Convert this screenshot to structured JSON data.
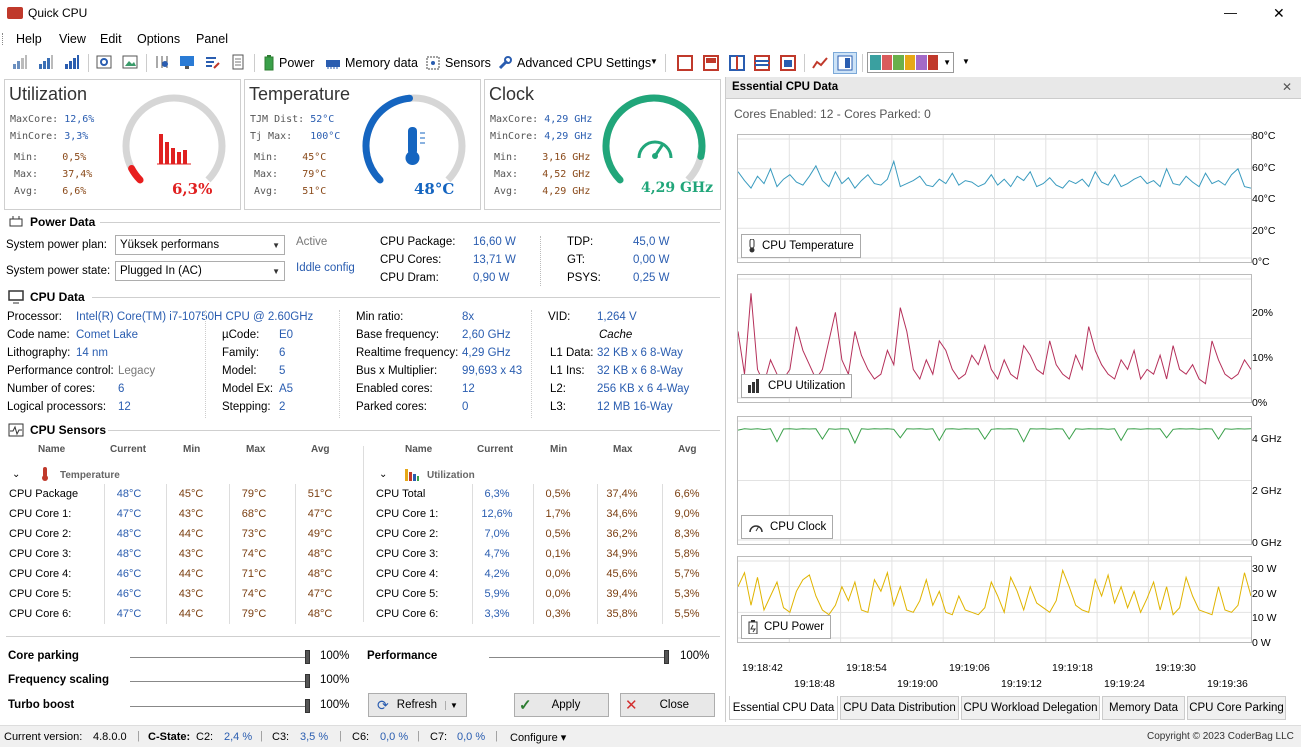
{
  "window": {
    "title": "Quick CPU",
    "min": "—",
    "max": "☐",
    "close": "✕"
  },
  "menu": [
    "Help",
    "View",
    "Edit",
    "Options",
    "Panel"
  ],
  "toolbar": {
    "power": "Power",
    "memory": "Memory data",
    "sensors": "Sensors",
    "advanced": "Advanced CPU Settings"
  },
  "gauges": {
    "utilization": {
      "title": "Utilization",
      "maxcore_l": "MaxCore:",
      "maxcore": "12,6%",
      "mincore_l": "MinCore:",
      "mincore": "3,3%",
      "min_l": "Min:",
      "min": "0,5%",
      "max_l": "Max:",
      "max": "37,4%",
      "avg_l": "Avg:",
      "avg": "6,6%",
      "value": "6,3%",
      "level": 0.063,
      "color": "#e81e1e"
    },
    "temperature": {
      "title": "Temperature",
      "tjm_l": "TJM Dist:",
      "tjm": "52°C",
      "tjmax_l": "Tj Max:",
      "tjmax": "100°C",
      "min_l": "Min:",
      "min": "45°C",
      "max_l": "Max:",
      "max": "79°C",
      "avg_l": "Avg:",
      "avg": "51°C",
      "value": "48°C",
      "level": 0.48,
      "color": "#1565c0"
    },
    "clock": {
      "title": "Clock",
      "maxcore_l": "MaxCore:",
      "maxcore": "4,29 GHz",
      "mincore_l": "MinCore:",
      "mincore": "4,29 GHz",
      "min_l": "Min:",
      "min": "3,16 GHz",
      "max_l": "Max:",
      "max": "4,52 GHz",
      "avg_l": "Avg:",
      "avg": "4,29 GHz",
      "value": "4,29 GHz",
      "level": 0.88,
      "color": "#21a67a"
    }
  },
  "power": {
    "header": "Power Data",
    "plan_label": "System power plan:",
    "plan_value": "Yüksek performans",
    "plan_status": "Active",
    "state_label": "System power state:",
    "state_value": "Plugged In (AC)",
    "state_link": "Iddle config",
    "pkg_l": "CPU Package:",
    "pkg": "16,60 W",
    "cores_l": "CPU Cores:",
    "cores": "13,71 W",
    "dram_l": "CPU Dram:",
    "dram": "0,90 W",
    "tdp_l": "TDP:",
    "tdp": "45,0 W",
    "gt_l": "GT:",
    "gt": "0,00 W",
    "psys_l": "PSYS:",
    "psys": "0,25 W"
  },
  "cpu": {
    "header": "CPU Data",
    "proc_l": "Processor:",
    "proc": "Intel(R) Core(TM) i7-10750H CPU @ 2.60GHz",
    "code_l": "Code name:",
    "code": "Comet Lake",
    "lith_l": "Lithography:",
    "lith": "14 nm",
    "perf_l": "Performance control:",
    "perf": "Legacy",
    "ncores_l": "Number of cores:",
    "ncores": "6",
    "logical_l": "Logical processors:",
    "logical": "12",
    "ucode_l": "µCode:",
    "ucode": "E0",
    "family_l": "Family:",
    "family": "6",
    "model_l": "Model:",
    "model": "5",
    "modelex_l": "Model Ex:",
    "modelex": "A5",
    "step_l": "Stepping:",
    "step": "2",
    "minratio_l": "Min ratio:",
    "minratio": "8x",
    "basefreq_l": "Base frequency:",
    "basefreq": "2,60 GHz",
    "rtfreq_l": "Realtime frequency:",
    "rtfreq": "4,29 GHz",
    "bus_l": "Bus x Multiplier:",
    "bus": "99,693 x 43",
    "enabled_l": "Enabled cores:",
    "enabled": "12",
    "parked_l": "Parked cores:",
    "parked": "0",
    "vid_l": "VID:",
    "vid": "1,264 V",
    "cache": "Cache",
    "l1d_l": "L1 Data:",
    "l1d": "32 KB x 6  8-Way",
    "l1i_l": "L1 Ins:",
    "l1i": "32 KB x 6  8-Way",
    "l2_l": "L2:",
    "l2": "256 KB x 6  4-Way",
    "l3_l": "L3:",
    "l3": "12 MB  16-Way"
  },
  "sensors": {
    "header": "CPU Sensors",
    "cols": [
      "Name",
      "Current",
      "Min",
      "Max",
      "Avg"
    ],
    "temp_group": "Temperature",
    "util_group": "Utilization",
    "temp_rows": [
      [
        "CPU Package",
        "48°C",
        "45°C",
        "79°C",
        "51°C"
      ],
      [
        "CPU Core 1:",
        "47°C",
        "43°C",
        "68°C",
        "47°C"
      ],
      [
        "CPU Core 2:",
        "48°C",
        "44°C",
        "73°C",
        "49°C"
      ],
      [
        "CPU Core 3:",
        "48°C",
        "43°C",
        "74°C",
        "48°C"
      ],
      [
        "CPU Core 4:",
        "46°C",
        "44°C",
        "71°C",
        "48°C"
      ],
      [
        "CPU Core 5:",
        "46°C",
        "43°C",
        "74°C",
        "47°C"
      ],
      [
        "CPU Core 6:",
        "47°C",
        "44°C",
        "79°C",
        "48°C"
      ]
    ],
    "util_rows": [
      [
        "CPU Total",
        "6,3%",
        "0,5%",
        "37,4%",
        "6,6%"
      ],
      [
        "CPU Core 1:",
        "12,6%",
        "1,7%",
        "34,6%",
        "9,0%"
      ],
      [
        "CPU Core 2:",
        "7,0%",
        "0,5%",
        "36,2%",
        "8,3%"
      ],
      [
        "CPU Core 3:",
        "4,7%",
        "0,1%",
        "34,9%",
        "5,8%"
      ],
      [
        "CPU Core 4:",
        "4,2%",
        "0,0%",
        "45,6%",
        "5,7%"
      ],
      [
        "CPU Core 5:",
        "5,9%",
        "0,0%",
        "39,4%",
        "5,3%"
      ],
      [
        "CPU Core 6:",
        "3,3%",
        "0,3%",
        "35,8%",
        "5,5%"
      ]
    ]
  },
  "controls": {
    "parking_l": "Core parking",
    "parking": "100%",
    "parking_level": 1.0,
    "freq_l": "Frequency scaling",
    "freq": "100%",
    "freq_level": 1.0,
    "turbo_l": "Turbo boost",
    "turbo": "100%",
    "turbo_level": 1.0,
    "perf_l": "Performance",
    "perf": "100%",
    "perf_level": 1.0,
    "refresh": "Refresh",
    "apply": "Apply",
    "close": "Close"
  },
  "panel": {
    "title": "Essential CPU Data",
    "cores_info": "Cores Enabled: 12 - Cores Parked: 0",
    "x_top": [
      "19:18:42",
      "19:18:54",
      "19:19:06",
      "19:19:18",
      "19:19:30"
    ],
    "x_bottom": [
      "19:18:48",
      "19:19:00",
      "19:19:12",
      "19:19:24",
      "19:19:36"
    ],
    "tabs": [
      "Essential CPU Data",
      "CPU Data Distribution",
      "CPU Workload Delegation",
      "Memory Data",
      "CPU Core Parking"
    ]
  },
  "chart_data": [
    {
      "type": "line",
      "legend": "CPU Temperature",
      "yticks": [
        "80°C",
        "60°C",
        "40°C",
        "20°C",
        "0°C"
      ],
      "ylim": [
        0,
        80
      ],
      "color": "#3a9bbf",
      "values": [
        58,
        52,
        47,
        55,
        50,
        60,
        48,
        53,
        56,
        51,
        49,
        55,
        62,
        52,
        48,
        58,
        50,
        54,
        47,
        52,
        56,
        50,
        49,
        53,
        65,
        48,
        50,
        52,
        55,
        49,
        48,
        53,
        50,
        57,
        49,
        52,
        51,
        48,
        50,
        56,
        49,
        53,
        48,
        55,
        52,
        58,
        48,
        50,
        54,
        49,
        47,
        52,
        50,
        53,
        48,
        58,
        51,
        49,
        56,
        48,
        50,
        53,
        55,
        50,
        52,
        48,
        60,
        50,
        49,
        55,
        51,
        48,
        57,
        50,
        52,
        49,
        56,
        60,
        48,
        47
      ]
    },
    {
      "type": "line",
      "legend": "CPU Utilization",
      "yticks": [
        "20%",
        "10%",
        "0%"
      ],
      "ylim": [
        0,
        25
      ],
      "color": "#b5305a",
      "values": [
        14,
        5,
        22,
        6,
        3,
        8,
        5,
        4,
        6,
        15,
        10,
        7,
        4,
        6,
        12,
        18,
        8,
        5,
        14,
        9,
        6,
        4,
        5,
        10,
        7,
        19,
        14,
        6,
        4,
        8,
        5,
        12,
        10,
        6,
        4,
        5,
        9,
        7,
        11,
        6,
        4,
        8,
        5,
        4,
        11,
        9,
        6,
        5,
        12,
        7,
        5,
        4,
        9,
        6,
        15,
        10,
        7,
        5,
        4,
        8,
        6,
        10,
        4,
        6,
        5,
        9,
        4,
        11,
        6,
        5,
        7,
        4,
        3,
        12,
        8,
        5,
        4,
        5,
        8,
        6
      ]
    },
    {
      "type": "line",
      "legend": "CPU Clock",
      "yticks": [
        "4 GHz",
        "2 GHz",
        "0 GHz"
      ],
      "ylim": [
        0,
        4.6
      ],
      "color": "#3aa04a",
      "values": [
        4.25,
        4.3,
        4.28,
        4.3,
        4.27,
        4.3,
        3.8,
        4.29,
        4.3,
        4.28,
        4.3,
        4.29,
        4.3,
        3.9,
        4.3,
        4.28,
        4.3,
        4.29,
        3.75,
        4.3,
        4.28,
        4.3,
        4.29,
        4.3,
        4.28,
        3.95,
        4.3,
        4.29,
        4.3,
        4.28,
        4.3,
        3.85,
        4.29,
        4.3,
        4.28,
        4.3,
        4.29,
        4.3,
        3.9,
        4.28,
        4.3,
        4.29,
        4.3,
        4.28,
        3.8,
        4.3,
        4.29,
        4.3,
        4.28,
        4.3,
        4.29,
        3.9,
        4.3,
        4.28,
        4.3,
        4.29,
        4.3,
        4.28,
        4.3,
        3.85,
        4.29,
        4.3,
        4.28,
        4.3,
        4.29,
        4.3,
        3.95,
        4.28,
        4.3,
        4.29,
        4.3,
        4.28,
        4.3,
        4.29,
        3.9,
        4.3,
        4.28,
        4.3,
        4.29,
        4.3
      ]
    },
    {
      "type": "line",
      "legend": "CPU Power",
      "yticks": [
        "30 W",
        "20 W",
        "10 W",
        "0 W"
      ],
      "ylim": [
        0,
        33
      ],
      "color": "#e0b400",
      "values": [
        22,
        28,
        14,
        26,
        12,
        18,
        24,
        13,
        11,
        20,
        25,
        27,
        18,
        12,
        10,
        14,
        22,
        16,
        24,
        12,
        11,
        25,
        20,
        28,
        14,
        22,
        12,
        11,
        16,
        25,
        14,
        20,
        11,
        10,
        18,
        12,
        11,
        10,
        13,
        24,
        18,
        11,
        26,
        20,
        12,
        22,
        15,
        13,
        11,
        16,
        29,
        22,
        14,
        12,
        11,
        25,
        18,
        27,
        15,
        22,
        13,
        20,
        11,
        17,
        24,
        12,
        22,
        10,
        13,
        26,
        18,
        12,
        11,
        10,
        22,
        12,
        11,
        14,
        28,
        18
      ]
    }
  ],
  "status": {
    "version_l": "Current version:",
    "version": "4.8.0.0",
    "cstate_l": "C-State:",
    "c2_l": "C2:",
    "c2": "2,4 %",
    "c3_l": "C3:",
    "c3": "3,5 %",
    "c6_l": "C6:",
    "c6": "0,0 %",
    "c7_l": "C7:",
    "c7": "0,0 %",
    "configure": "Configure ▾",
    "copyright": "Copyright © 2023 CoderBag LLC"
  }
}
